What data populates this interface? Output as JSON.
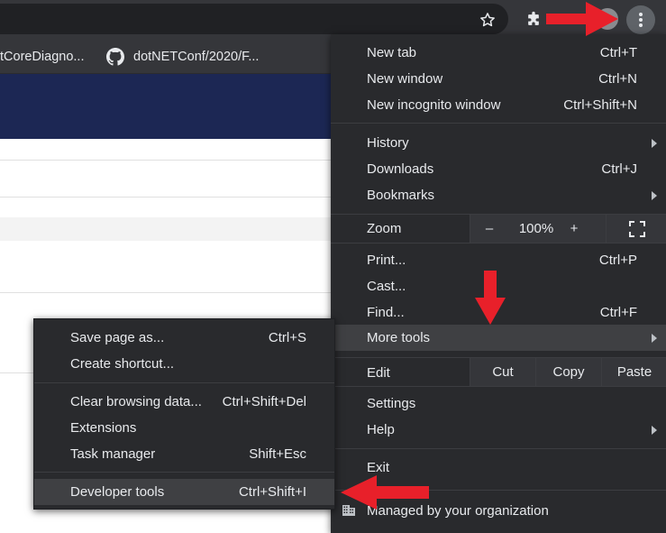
{
  "browser": {
    "bookmarks": [
      {
        "label": "tCoreDiagno..."
      },
      {
        "label": "dotNETConf/2020/F..."
      }
    ],
    "icons": {
      "star": "star-icon",
      "extensions": "puzzle-icon",
      "menu": "kebab-menu-icon"
    }
  },
  "main_menu": {
    "items": [
      {
        "label": "New tab",
        "shortcut": "Ctrl+T"
      },
      {
        "label": "New window",
        "shortcut": "Ctrl+N"
      },
      {
        "label": "New incognito window",
        "shortcut": "Ctrl+Shift+N"
      },
      {
        "label": "History",
        "shortcut": ""
      },
      {
        "label": "Downloads",
        "shortcut": "Ctrl+J"
      },
      {
        "label": "Bookmarks",
        "shortcut": ""
      },
      {
        "label": "Print...",
        "shortcut": "Ctrl+P"
      },
      {
        "label": "Cast...",
        "shortcut": ""
      },
      {
        "label": "Find...",
        "shortcut": "Ctrl+F"
      },
      {
        "label": "More tools",
        "shortcut": ""
      },
      {
        "label": "Settings",
        "shortcut": ""
      },
      {
        "label": "Help",
        "shortcut": ""
      },
      {
        "label": "Exit",
        "shortcut": ""
      }
    ],
    "zoom": {
      "label": "Zoom",
      "minus": "–",
      "value": "100%",
      "plus": "+"
    },
    "edit": {
      "label": "Edit",
      "cut": "Cut",
      "copy": "Copy",
      "paste": "Paste"
    },
    "managed": "Managed by your organization"
  },
  "more_tools_menu": {
    "items": [
      {
        "label": "Save page as...",
        "shortcut": "Ctrl+S"
      },
      {
        "label": "Create shortcut...",
        "shortcut": ""
      },
      {
        "label": "Clear browsing data...",
        "shortcut": "Ctrl+Shift+Del"
      },
      {
        "label": "Extensions",
        "shortcut": ""
      },
      {
        "label": "Task manager",
        "shortcut": "Shift+Esc"
      },
      {
        "label": "Developer tools",
        "shortcut": "Ctrl+Shift+I"
      }
    ]
  },
  "colors": {
    "menu_bg": "#292a2d",
    "menu_highlight": "#3f4043",
    "toolbar_bg": "#35363a",
    "page_banner": "#1c2754",
    "annotation_arrow": "#e8202a"
  }
}
